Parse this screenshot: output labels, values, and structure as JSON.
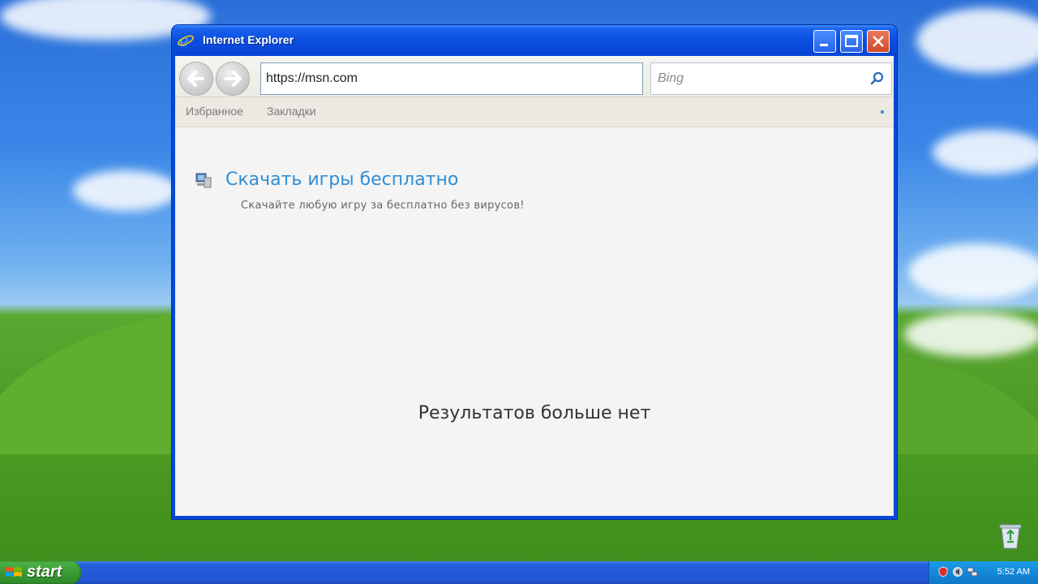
{
  "window": {
    "title": "Internet Explorer"
  },
  "toolbar": {
    "address": "https://msn.com",
    "search_placeholder": "Bing"
  },
  "favorites_bar": {
    "items": [
      "Избранное",
      "Закладки"
    ]
  },
  "results": [
    {
      "title": "Скачать игры бесплатно",
      "description": "Скачайте любую игру за бесплатно без вирусов!"
    }
  ],
  "no_more_results": "Результатов больше нет",
  "taskbar": {
    "start_label": "start",
    "clock": "5:52 AM"
  },
  "colors": {
    "titlebar": "#0a4ee0",
    "link": "#2f8fd6",
    "start_green": "#3a9a34"
  }
}
